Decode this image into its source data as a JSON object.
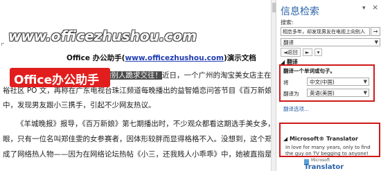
{
  "document": {
    "title_prefix": "Office 办公助手(",
    "title_url": "www.officezhushou.com",
    "title_suffix": ")演示文档",
    "line1_hl": "向别人跪求交往！",
    "line1_rest": "近日，一个广州的淘宝美女店主在天",
    "line2": "裕社区 PO 文，再称在广东电视台珠江频道每晚播出的益智婚恋问答节目《百万新娘",
    "line3": "中，发现男友跟小三携手，引起不少网友热议。",
    "line4": "《羊城晚报》报导，《百万新娘》第七期播出时，不少观众都看这期选手美女多，很养",
    "line5": "眼，只有一位名叫郑佳雯的女参赛者，因体形较胖而显得格格不入。没想到，这个郑佳雯却",
    "line6": "成了网络热人物——因为在网络论坛热帖《小三，还我贱人小乖乖》中，她被直指是小三。",
    "logo_text": "Office办公助手",
    "watermark": "www.officezhushou.com"
  },
  "pane": {
    "title": "信息检索",
    "menu_glyph": "▾",
    "close_glyph": "×",
    "search_label": "搜索:",
    "search_value": "相恋多年，却发现男友在电视上向别人",
    "search_go": "→",
    "service_value": "翻译",
    "nav_back": "◄返回",
    "nav_fwd": "►",
    "nav_extra": "▾",
    "section_translate": "翻译",
    "translate_subhead": "翻译一个单词或句子。",
    "from_label": "将",
    "from_value": "中文(中国)",
    "to_label": "翻译为",
    "to_value": "英语(美国)",
    "more_link": "翻译选项...",
    "section_ms": "Microsoft® Translator",
    "ms_result": "In love for many years, only to find the guy on TV begging to anyone!",
    "ms_logo_small": "Microsoft",
    "ms_logo_big": "Translator"
  },
  "colors": {
    "accent_red": "#d01818",
    "title_blue": "#2a62a8",
    "logo_red": "#e11d1d"
  }
}
